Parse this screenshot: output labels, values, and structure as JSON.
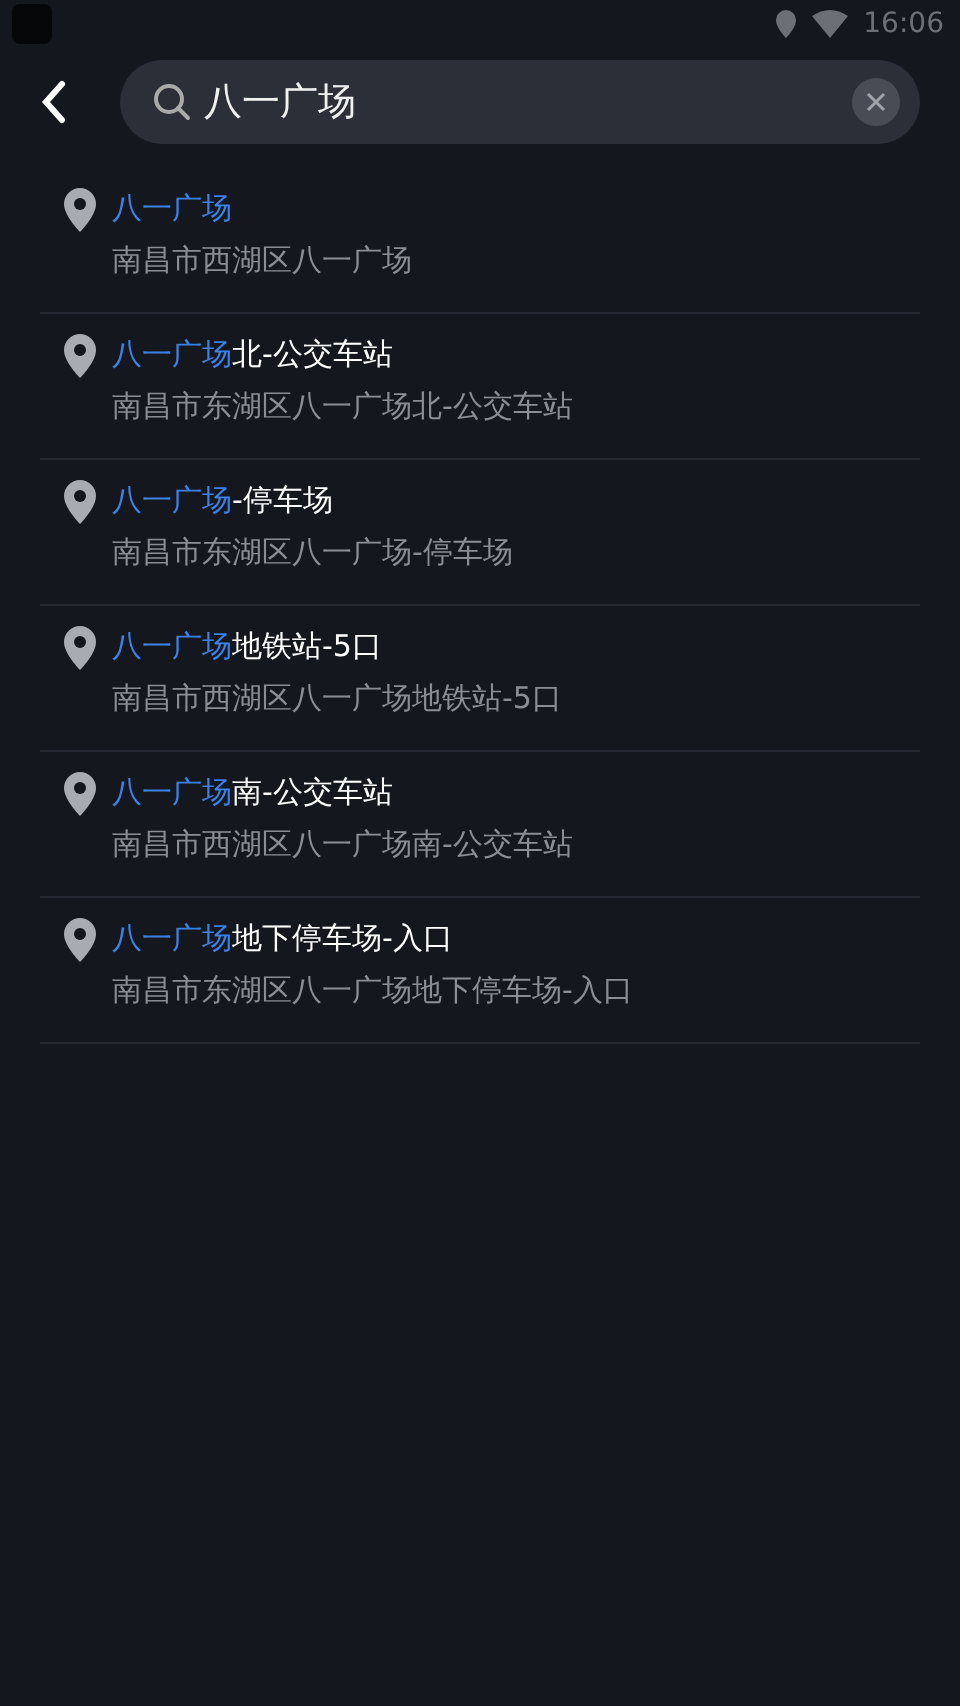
{
  "status_bar": {
    "time": "16:06"
  },
  "search": {
    "value": "八一广场"
  },
  "results": [
    {
      "match": "八一广场",
      "address": "南昌市西湖区八一广场"
    },
    {
      "match": "八一广场",
      "rest": "北-公交车站",
      "address": "南昌市东湖区八一广场北-公交车站"
    },
    {
      "match": "八一广场",
      "rest": "-停车场",
      "address": "南昌市东湖区八一广场-停车场"
    },
    {
      "match": "八一广场",
      "rest": "地铁站-5口",
      "address": "南昌市西湖区八一广场地铁站-5口"
    },
    {
      "match": "八一广场",
      "rest": "南-公交车站",
      "address": "南昌市西湖区八一广场南-公交车站"
    },
    {
      "match": "八一广场",
      "rest": "地下停车场-入口",
      "address": "南昌市东湖区八一广场地下停车场-入口"
    }
  ]
}
